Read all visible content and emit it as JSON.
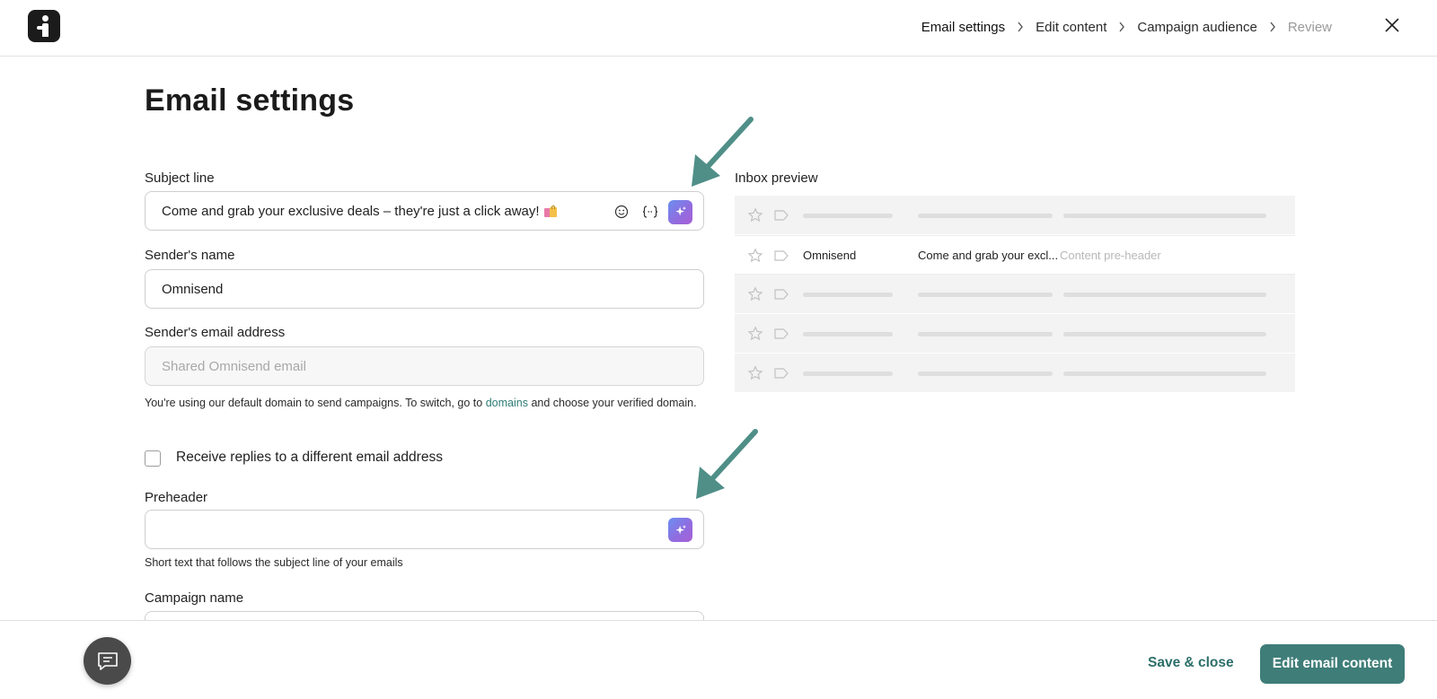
{
  "header": {
    "steps": [
      {
        "label": "Email settings",
        "state": "active"
      },
      {
        "label": "Edit content",
        "state": "default"
      },
      {
        "label": "Campaign audience",
        "state": "default"
      },
      {
        "label": "Review",
        "state": "muted"
      }
    ],
    "icons": {
      "logo": "omnisend-logo",
      "close": "close-icon",
      "separator": "chevron-right-icon"
    }
  },
  "page": {
    "title": "Email settings"
  },
  "form": {
    "subject": {
      "label": "Subject line",
      "value": "Come and grab your exclusive deals – they're just a click away!",
      "trailing_emoji": "shopping-bags-emoji",
      "tools": [
        "emoji-icon",
        "personalization-icon",
        "ai-sparkle-icon"
      ]
    },
    "sender_name": {
      "label": "Sender's name",
      "value": "Omnisend"
    },
    "sender_email": {
      "label": "Sender's email address",
      "placeholder": "Shared Omnisend email",
      "help_before": "You're using our default domain to send campaigns. To switch, go to ",
      "help_link": "domains",
      "help_after": " and choose your verified domain."
    },
    "reply_to": {
      "label": "Receive replies to a different email address",
      "checked": false
    },
    "preheader": {
      "label": "Preheader",
      "value": "",
      "help": "Short text that follows the subject line of your emails",
      "tools": [
        "ai-sparkle-icon"
      ]
    },
    "campaign_name": {
      "label": "Campaign name"
    }
  },
  "inbox_preview": {
    "label": "Inbox preview",
    "active_row": {
      "sender": "Omnisend",
      "subject": "Come and grab your excl...",
      "preheader": "Content pre-header"
    }
  },
  "footer": {
    "save_close": "Save & close",
    "primary": "Edit email content",
    "chat_icon": "chat-icon"
  },
  "colors": {
    "accent": "#3f7d78",
    "link": "#2d7c76",
    "arrow": "#4f8f88"
  }
}
